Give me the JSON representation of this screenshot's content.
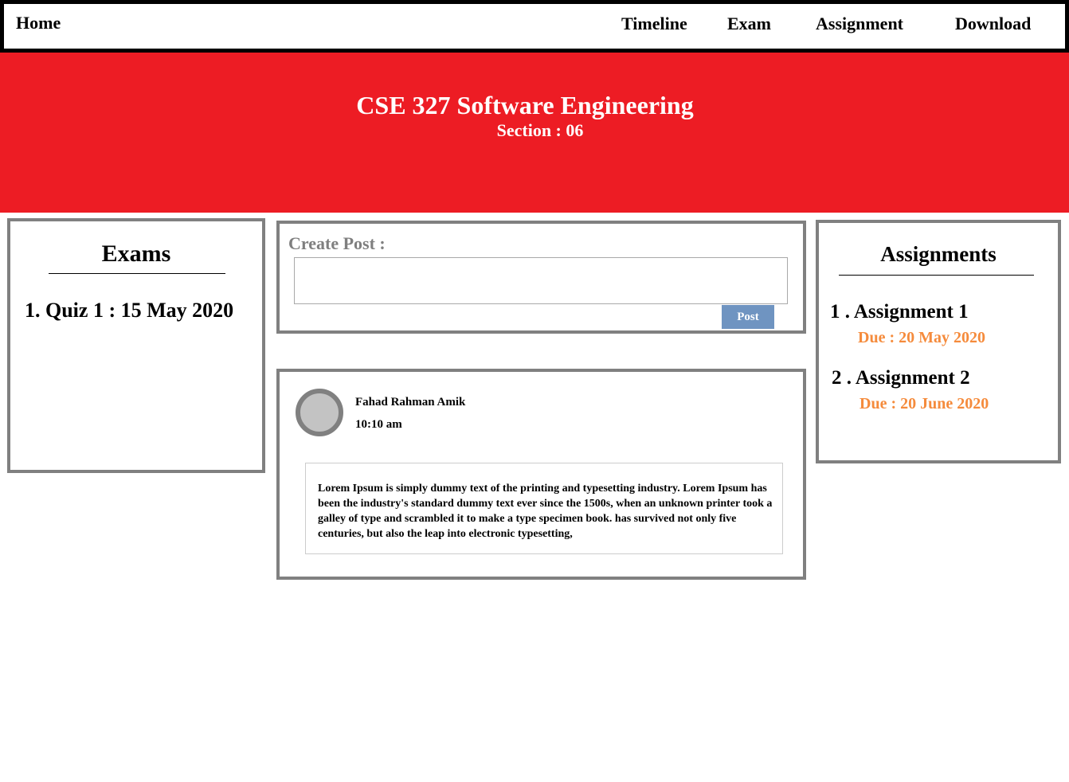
{
  "nav": {
    "home": "Home",
    "links": [
      "Timeline",
      "Exam",
      "Assignment",
      "Download"
    ]
  },
  "banner": {
    "title": "CSE 327 Software Engineering",
    "section": "Section : 06",
    "background_color": "#ed1c24"
  },
  "exams": {
    "title": "Exams",
    "items": [
      "1. Quiz 1 : 15 May 2020"
    ]
  },
  "create_post": {
    "label": "Create Post :",
    "input_value": "",
    "button_label": "Post",
    "button_color": "#6f94c1"
  },
  "post": {
    "author": "Fahad Rahman Amik",
    "time": "10:10 am",
    "avatar_icon": "avatar-circle-icon",
    "body": "Lorem Ipsum is simply dummy text of the printing and typesetting industry. Lorem Ipsum has been the industry's standard dummy text ever since the 1500s, when an unknown printer took a galley of type and scrambled it to make a type specimen book. has survived not only five centuries, but also the leap into electronic typesetting,"
  },
  "assignments": {
    "title": "Assignments",
    "due_color": "#f58b3c",
    "items": [
      {
        "name": "1 . Assignment 1",
        "due": "Due : 20 May 2020"
      },
      {
        "name": "2 . Assignment 2",
        "due": "Due : 20 June 2020"
      }
    ]
  }
}
